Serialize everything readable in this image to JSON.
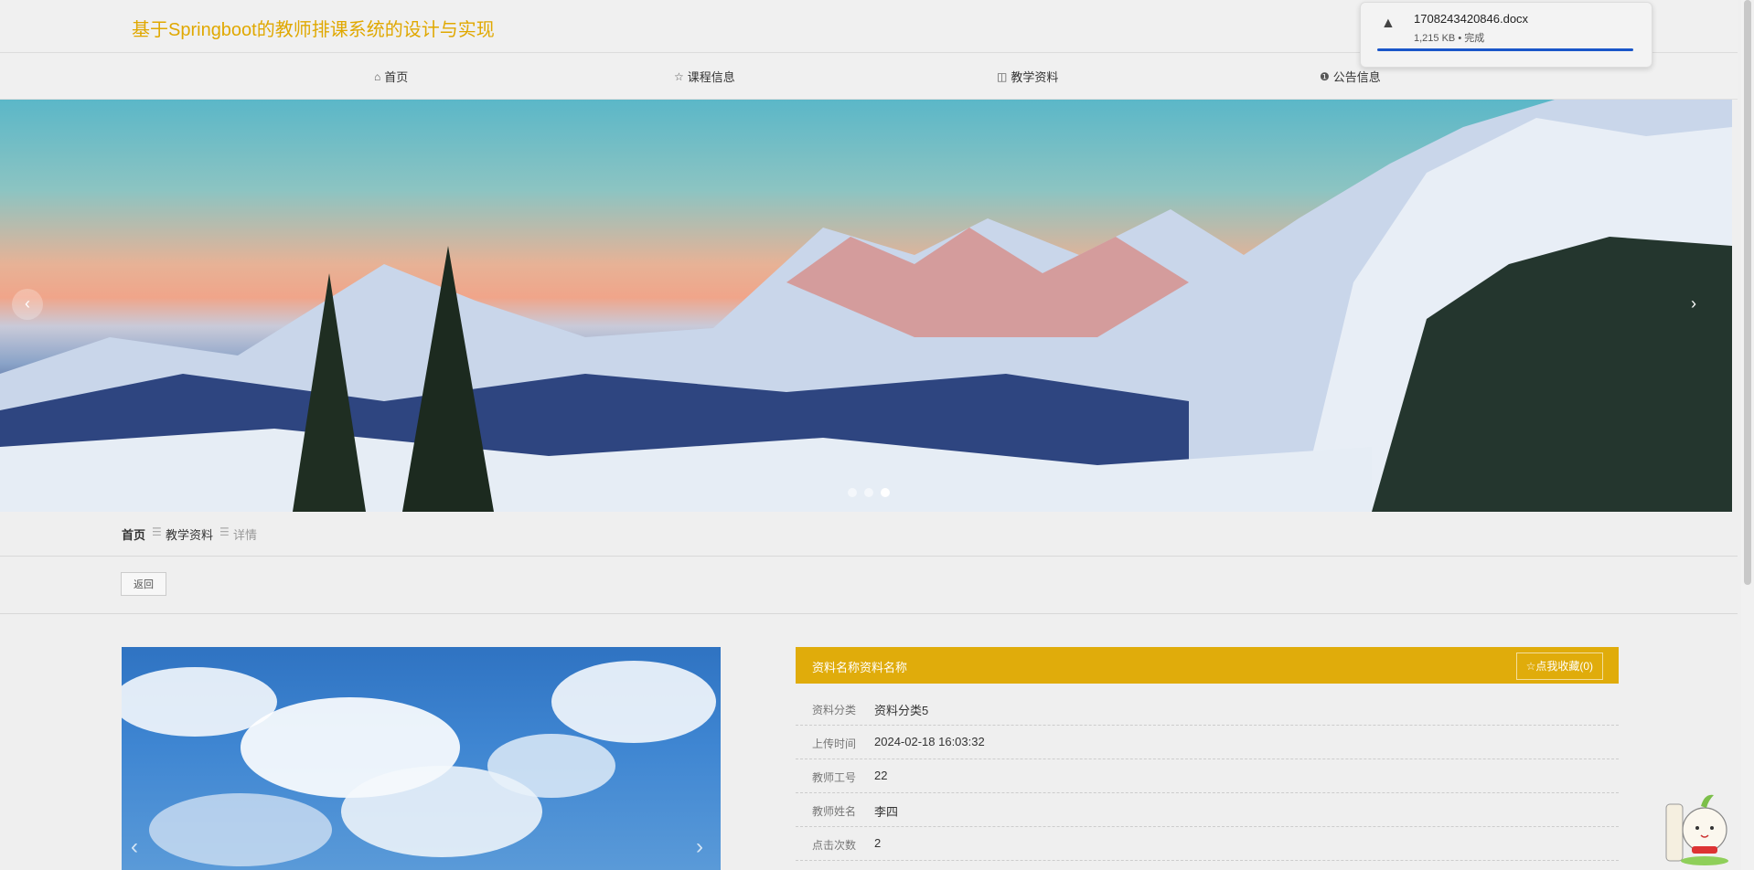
{
  "site": {
    "title": "基于Springboot的教师排课系统的设计与实现"
  },
  "nav": [
    {
      "label": "首页",
      "icon": "home-icon"
    },
    {
      "label": "课程信息",
      "icon": "star-icon"
    },
    {
      "label": "教学资料",
      "icon": "bag-icon"
    },
    {
      "label": "公告信息",
      "icon": "info-icon"
    }
  ],
  "carousel": {
    "prev": "‹",
    "next": "›",
    "slides": 3,
    "active_slide": 3
  },
  "breadcrumb": {
    "home": "首页",
    "section": "教学资料",
    "current": "详情",
    "sep": "☰"
  },
  "actions": {
    "back_label": "返回"
  },
  "detail": {
    "title": "资料名称资料名称",
    "favorite_label": "点我收藏(0)",
    "rows": [
      {
        "label": "资料分类",
        "value": "资料分类5"
      },
      {
        "label": "上传时间",
        "value": "2024-02-18 16:03:32"
      },
      {
        "label": "教师工号",
        "value": "22"
      },
      {
        "label": "教师姓名",
        "value": "李四"
      },
      {
        "label": "点击次数",
        "value": "2"
      }
    ]
  },
  "download": {
    "filename": "1708243420846.docx",
    "status": "1,215 KB • 完成",
    "progress": 1.0
  },
  "colors": {
    "accent": "#e0ac0b",
    "title": "#e0a800",
    "download_bar": "#1a56c9"
  }
}
